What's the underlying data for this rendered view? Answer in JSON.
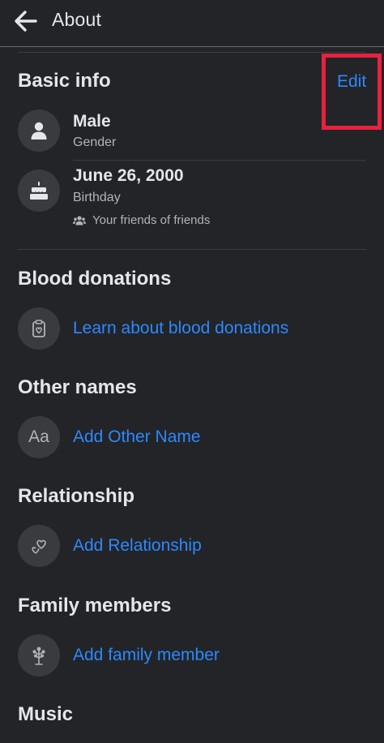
{
  "header": {
    "title": "About",
    "back_icon": "arrow-left-icon"
  },
  "basic_info": {
    "title": "Basic info",
    "edit_label": "Edit",
    "gender": {
      "value": "Male",
      "label": "Gender",
      "icon": "person-icon"
    },
    "birthday": {
      "value": "June 26, 2000",
      "label": "Birthday",
      "icon": "cake-icon",
      "audience": "Your friends of friends",
      "audience_icon": "friends-icon"
    }
  },
  "blood_donations": {
    "title": "Blood donations",
    "link": "Learn about blood donations",
    "icon": "clipboard-heart-icon"
  },
  "other_names": {
    "title": "Other names",
    "link": "Add Other Name",
    "icon_text": "Aa"
  },
  "relationship": {
    "title": "Relationship",
    "link": "Add Relationship",
    "icon": "hearts-icon"
  },
  "family_members": {
    "title": "Family members",
    "link": "Add family member",
    "icon": "family-tree-icon"
  },
  "music": {
    "title": "Music"
  },
  "colors": {
    "background": "#232427",
    "link": "#2d88ff",
    "highlight": "#e8213e",
    "icon_circle": "#3a3b3e"
  }
}
